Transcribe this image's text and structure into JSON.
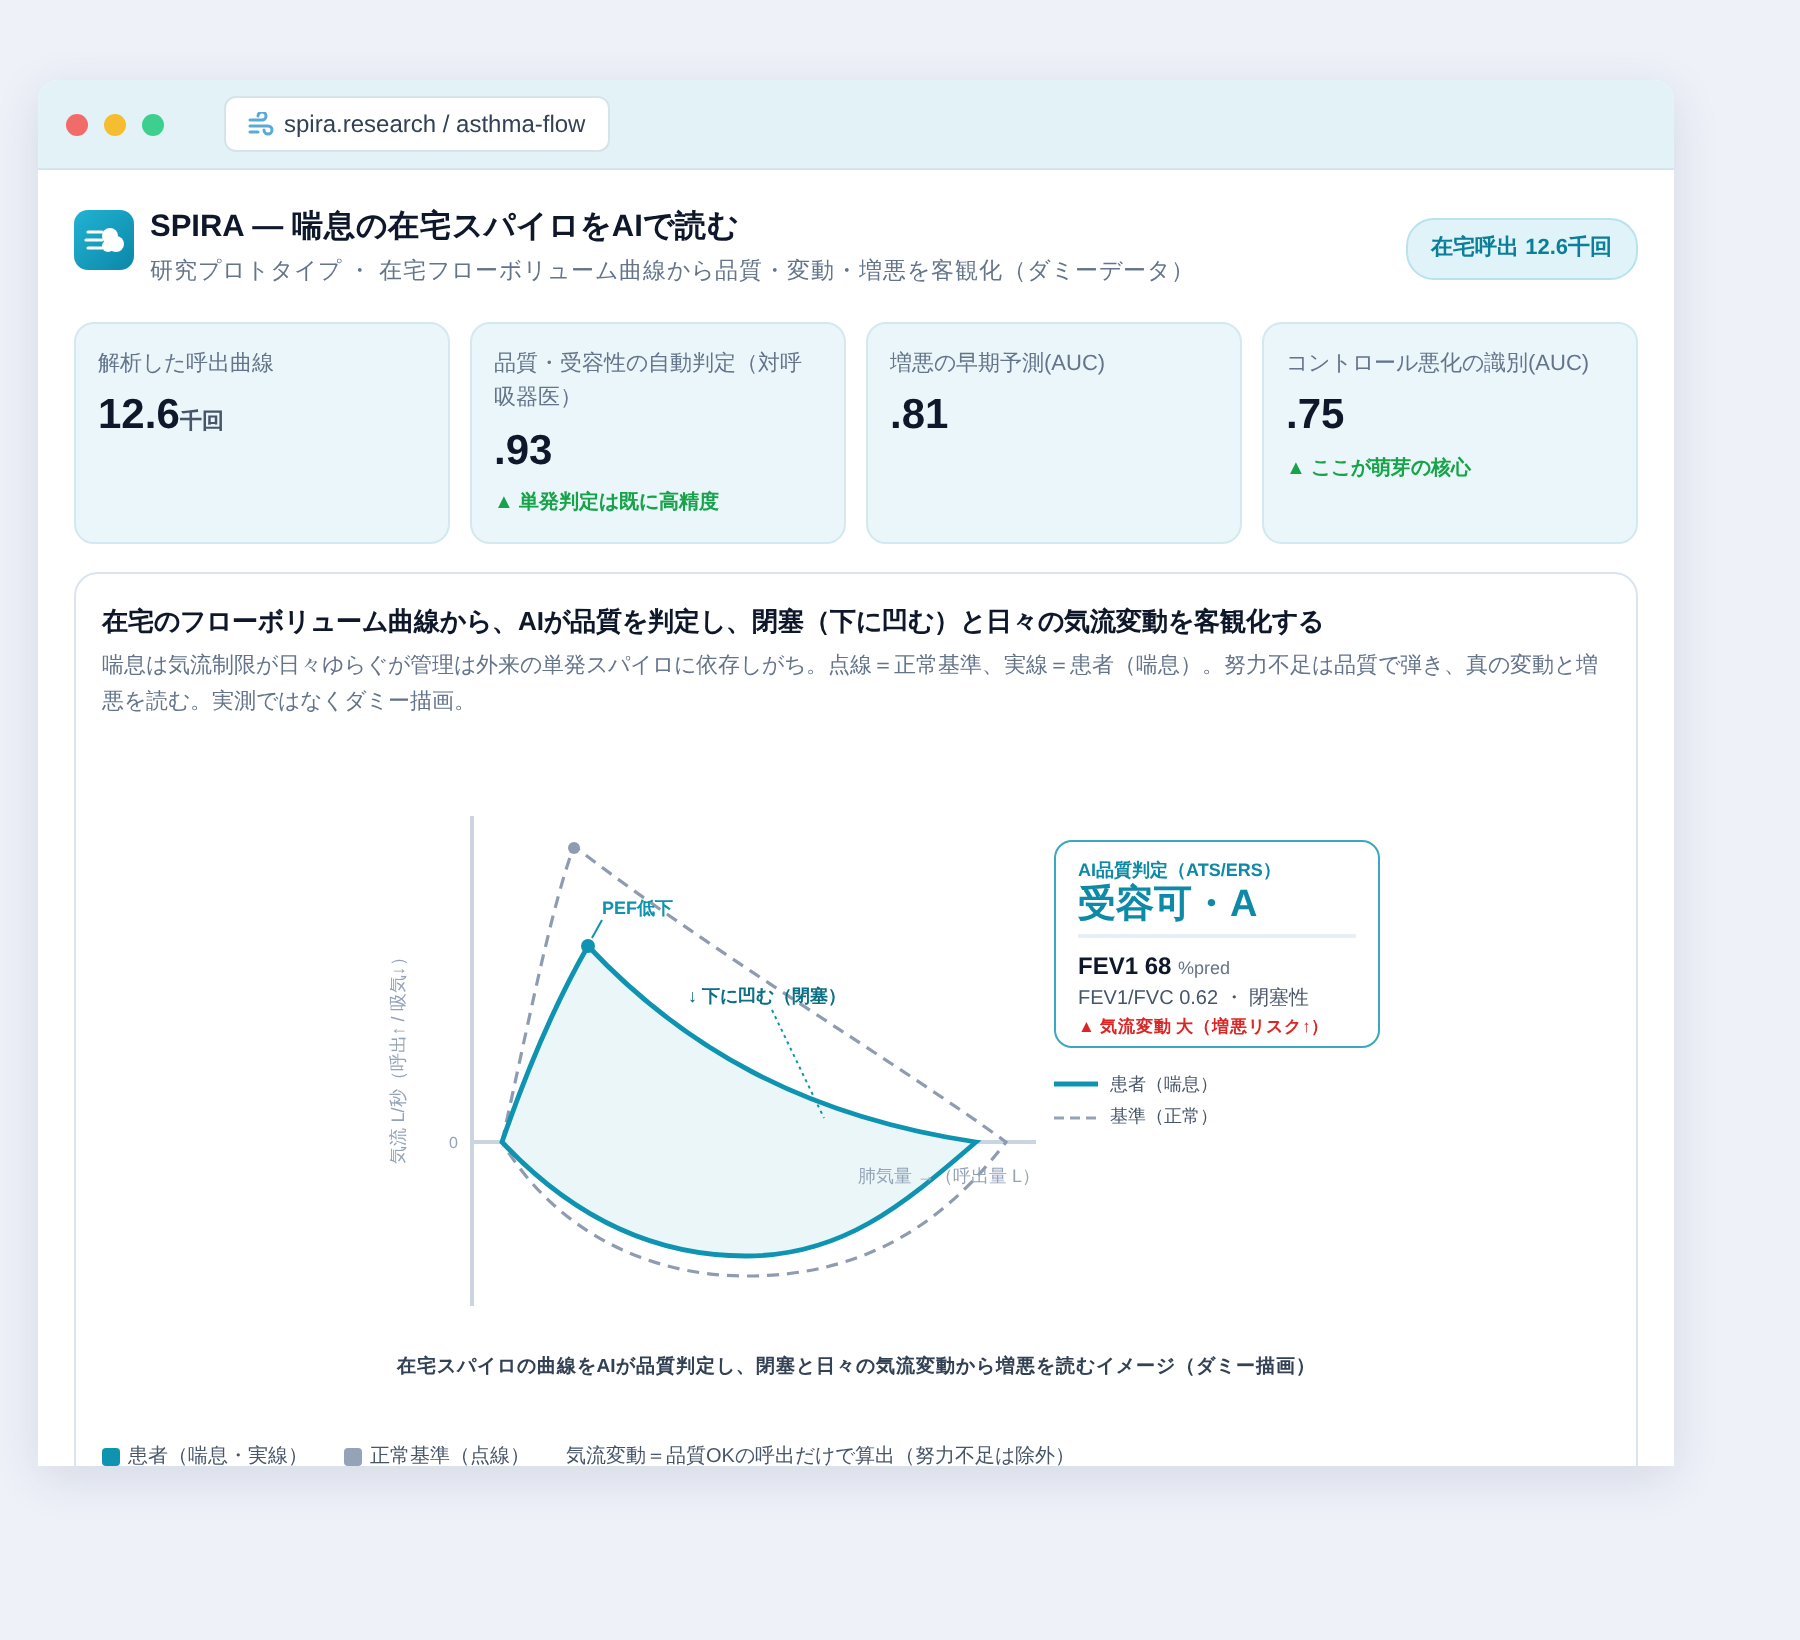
{
  "window": {
    "url": "spira.research / asthma-flow"
  },
  "header": {
    "title": "SPIRA — 喘息の在宅スパイロをAIで読む",
    "subtitle": "研究プロトタイプ ・ 在宅フローボリューム曲線から品質・変動・増悪を客観化（ダミーデータ）",
    "badge": "在宅呼出 12.6千回"
  },
  "stats": [
    {
      "label": "解析した呼出曲線",
      "value": "12.6",
      "unit": "千回"
    },
    {
      "label": "品質・受容性の自動判定（対呼吸器医）",
      "value": ".93",
      "note": "▲ 単発判定は既に高精度"
    },
    {
      "label": "増悪の早期予測(AUC)",
      "value": ".81"
    },
    {
      "label": "コントロール悪化の識別(AUC)",
      "value": ".75",
      "note": "▲ ここが萌芽の核心"
    }
  ],
  "panel": {
    "title": "在宅のフローボリューム曲線から、AIが品質を判定し、閉塞（下に凹む）と日々の気流変動を客観化する",
    "description": "喘息は気流制限が日々ゆらぐが管理は外来の単発スパイロに依存しがち。点線＝正常基準、実線＝患者（喘息）。努力不足は品質で弾き、真の変動と増悪を読む。実測ではなくダミー描画。",
    "figure": {
      "y_axis_label": "気流 L/秒（呼出↑ / 吸気↓）",
      "zero_label": "0",
      "x_axis_label": "肺気量 →（呼出量 L）",
      "pef_label": "PEF低下",
      "concave_label": "↓ 下に凹む（閉塞）",
      "callout": {
        "heading": "AI品質判定（ATS/ERS）",
        "verdict": "受容可・A",
        "fev1": "FEV1 68",
        "fev1_unit": "%pred",
        "ratio": "FEV1/FVC 0.62 ・ 閉塞性",
        "alert": "▲ 気流変動 大（増悪リスク↑）"
      },
      "legend": [
        {
          "label": "患者（喘息）",
          "kind": "solid"
        },
        {
          "label": "基準（正常）",
          "kind": "dashed"
        }
      ]
    },
    "caption": "在宅スパイロの曲線をAIが品質判定し、閉塞と日々の気流変動から増悪を読むイメージ（ダミー描画）",
    "footer_legend": [
      {
        "label": "患者（喘息・実線）",
        "color": "#0e93b0"
      },
      {
        "label": "正常基準（点線）",
        "color": "#94a3b8"
      }
    ],
    "footer_note": "気流変動＝品質OKの呼出だけで算出（努力不足は除外）"
  }
}
